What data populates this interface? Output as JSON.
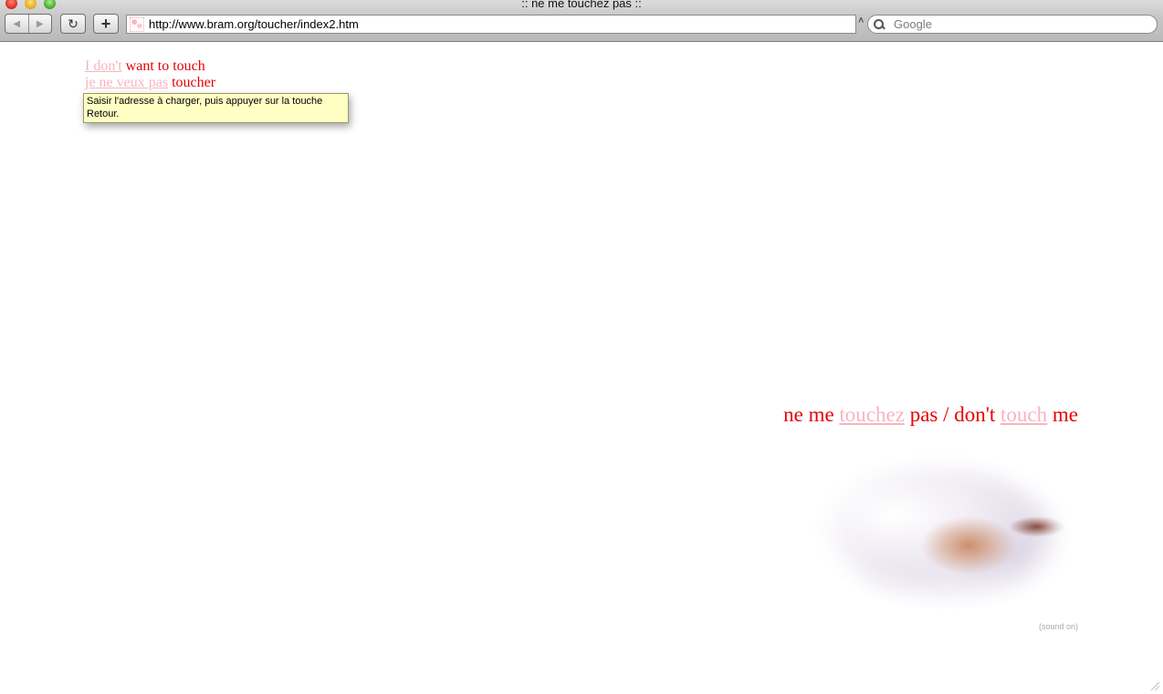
{
  "window": {
    "title": ":: ne me touchez pas ::"
  },
  "toolbar": {
    "back_icon": "◀",
    "forward_icon": "▶",
    "reload_icon": "↻",
    "add_bookmark_icon": "+",
    "url": "http://www.bram.org/toucher/index2.htm",
    "url_menu_icon": "˄",
    "search_placeholder": "Google"
  },
  "page": {
    "menu": [
      {
        "link": "I don't",
        "rest": " want to touch"
      },
      {
        "link": "je ne veux pas",
        "rest": " toucher"
      }
    ],
    "tooltip": "Saisir l'adresse à charger, puis appuyer sur la touche Retour.",
    "headline": {
      "part1": "ne me ",
      "link1": "touchez",
      "part2": " pas / don't ",
      "link2": "touch",
      "part3": " me"
    },
    "sound_note": "(sound on)"
  },
  "colors": {
    "text_red": "#e60000",
    "link_pink": "#f7b4c2",
    "tooltip_bg": "#ffffc4"
  }
}
